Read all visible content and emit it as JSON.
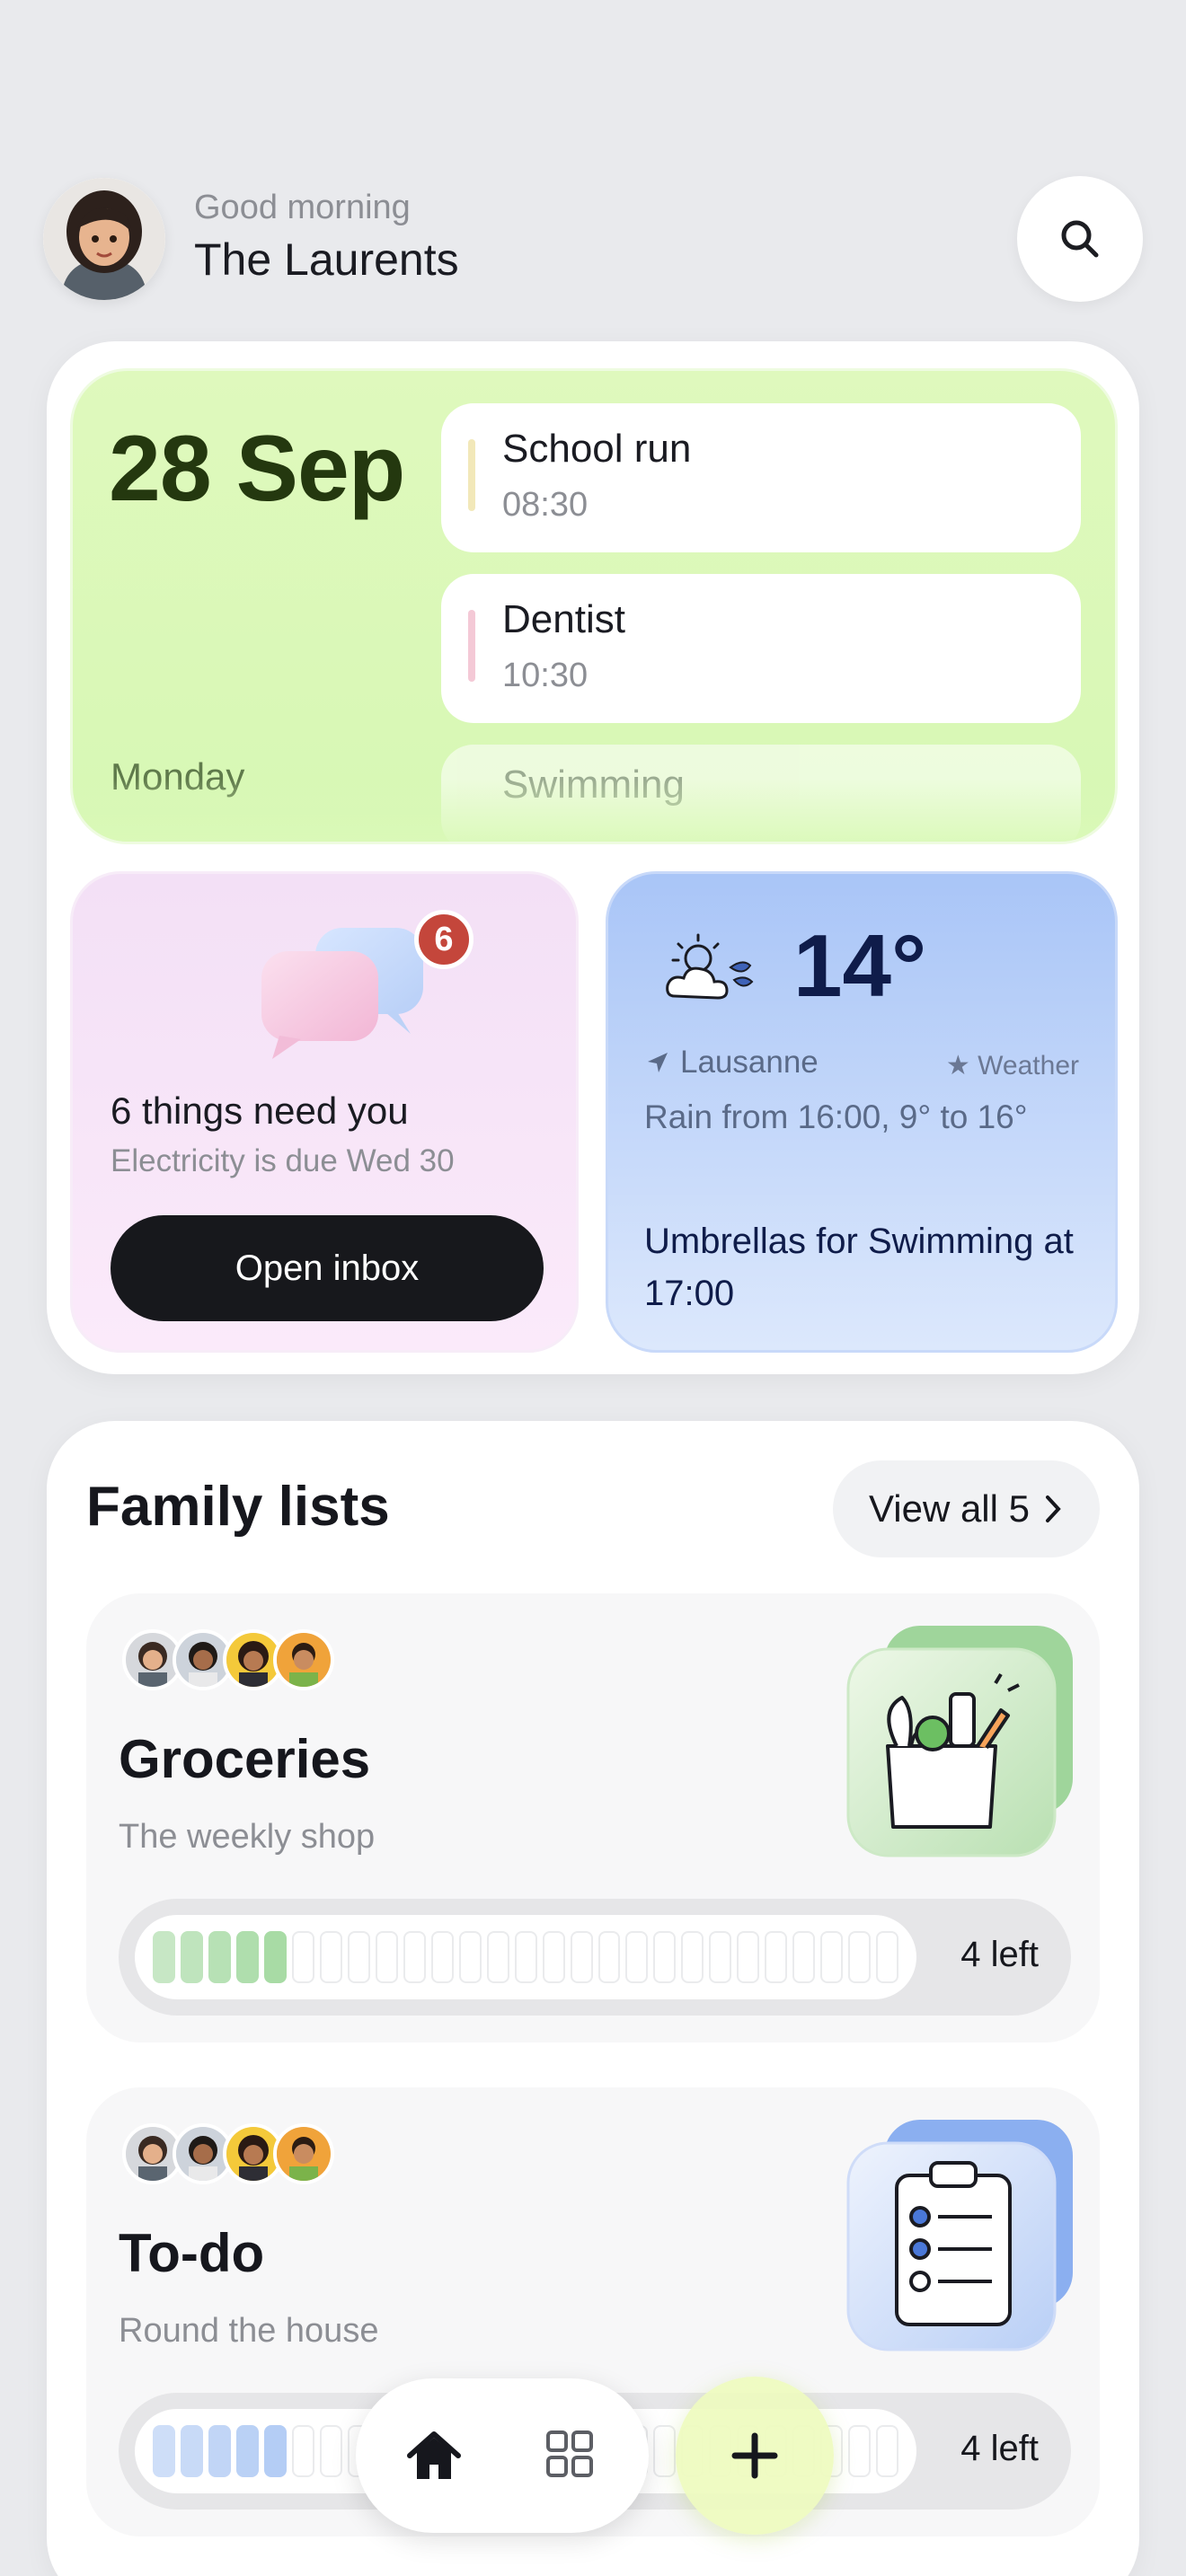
{
  "header": {
    "greeting": "Good morning",
    "family_name": "The Laurents",
    "search_icon": "search-icon"
  },
  "calendar": {
    "date": "28 Sep",
    "weekday": "Monday",
    "events": [
      {
        "title": "School run",
        "time": "08:30",
        "color": "#f2e8b9"
      },
      {
        "title": "Dentist",
        "time": "10:30",
        "color": "#f4c9d6"
      },
      {
        "title": "Swimming",
        "time": ""
      }
    ]
  },
  "inbox": {
    "badge_count": "6",
    "title": "6 things need you",
    "subtitle": "Electricity is due Wed 30",
    "button_label": "Open inbox"
  },
  "weather": {
    "temperature": "14°",
    "location": "Lausanne",
    "source_label": "Weather",
    "forecast": "Rain from 16:00, 9° to 16°",
    "advice": "Umbrellas for Swimming at 17:00"
  },
  "lists": {
    "title": "Family lists",
    "view_all_label": "View all 5",
    "items": [
      {
        "name": "Groceries",
        "subtitle": "The weekly shop",
        "remaining_label": "4 left",
        "progress_fraction": 0.19,
        "accent": "#a8dba5",
        "icon": "grocery-bag-icon"
      },
      {
        "name": "To-do",
        "subtitle": "Round the house",
        "remaining_label": "4 left",
        "progress_fraction": 0.19,
        "accent": "#b4cdf5",
        "icon": "clipboard-checklist-icon"
      }
    ]
  },
  "nav": {
    "items": [
      "home-icon",
      "grid-icon",
      "plus-icon"
    ]
  },
  "colors": {
    "calendar_bg": "#dcf9bb",
    "inbox_bg": "#f5e3f7",
    "weather_bg": "#b8d0f8",
    "primary_dark": "#17181c",
    "badge_red": "#c4463b"
  }
}
